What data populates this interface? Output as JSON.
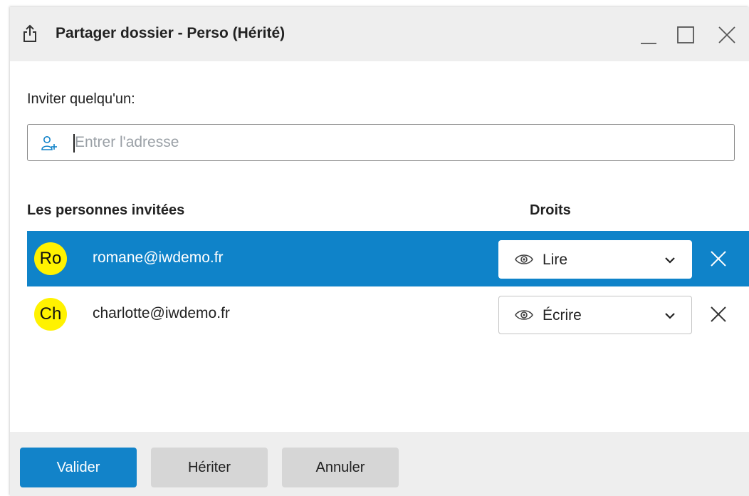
{
  "dialog": {
    "title": "Partager dossier - Perso (Hérité)",
    "title_icon": "share-upload-icon"
  },
  "window_controls": [
    "minimize-icon",
    "maximize-icon",
    "close-icon"
  ],
  "invite": {
    "label": "Inviter quelqu'un:",
    "placeholder": "Entrer l'adresse",
    "value": "",
    "icon": "add-user-icon"
  },
  "table": {
    "col_people": "Les personnes invitées",
    "col_rights": "Droits",
    "rows": [
      {
        "initials": "Ro",
        "email": "romane@iwdemo.fr",
        "right": "Lire",
        "selected": true
      },
      {
        "initials": "Ch",
        "email": "charlotte@iwdemo.fr",
        "right": "Écrire",
        "selected": false
      }
    ]
  },
  "footer": {
    "validate": "Valider",
    "inherit": "Hériter",
    "cancel": "Annuler"
  },
  "colors": {
    "accent": "#1283c9",
    "selected_row": "#0f83c9",
    "avatar": "#fff200",
    "footer_bg": "#eeeeee"
  }
}
